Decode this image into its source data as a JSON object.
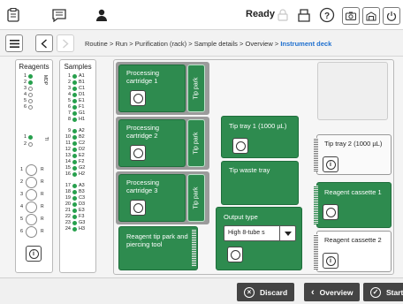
{
  "topbar": {
    "status": "Ready"
  },
  "nav": {
    "crumbs": [
      "Routine",
      ">",
      "Run",
      ">",
      "Purification (rack)",
      ">",
      "Sample details",
      ">",
      "Overview",
      ">"
    ],
    "current": "Instrument deck"
  },
  "reagents": {
    "title": "Reagents",
    "rows1": [
      {
        "n": "1",
        "f": true
      },
      {
        "n": "2",
        "f": true
      },
      {
        "n": "3",
        "f": false
      },
      {
        "n": "4",
        "f": false
      },
      {
        "n": "5",
        "f": false
      },
      {
        "n": "6",
        "f": false
      }
    ],
    "side1": "MDP",
    "rows2": [
      {
        "n": "1",
        "f": true
      },
      {
        "n": "2",
        "f": false
      }
    ],
    "side2": "TI",
    "big": [
      {
        "n": "1"
      },
      {
        "n": "2"
      },
      {
        "n": "3"
      },
      {
        "n": "4"
      },
      {
        "n": "5"
      },
      {
        "n": "6"
      }
    ],
    "bigside": [
      "R",
      "R",
      "R",
      "R",
      "R",
      "R"
    ]
  },
  "samples": {
    "title": "Samples",
    "groups": [
      [
        {
          "n": "1",
          "l": "A1"
        },
        {
          "n": "2",
          "l": "B1"
        },
        {
          "n": "3",
          "l": "C1"
        },
        {
          "n": "4",
          "l": "D1"
        },
        {
          "n": "5",
          "l": "E1"
        },
        {
          "n": "6",
          "l": "F1"
        },
        {
          "n": "7",
          "l": "G1"
        },
        {
          "n": "8",
          "l": "H1"
        }
      ],
      [
        {
          "n": "9",
          "l": "A2"
        },
        {
          "n": "10",
          "l": "B2"
        },
        {
          "n": "11",
          "l": "C2"
        },
        {
          "n": "12",
          "l": "D2"
        },
        {
          "n": "13",
          "l": "E2"
        },
        {
          "n": "14",
          "l": "F2"
        },
        {
          "n": "15",
          "l": "G2"
        },
        {
          "n": "16",
          "l": "H2"
        }
      ],
      [
        {
          "n": "17",
          "l": "A3"
        },
        {
          "n": "18",
          "l": "B3"
        },
        {
          "n": "19",
          "l": "C3"
        },
        {
          "n": "20",
          "l": "D3"
        },
        {
          "n": "21",
          "l": "E3"
        },
        {
          "n": "22",
          "l": "F3"
        },
        {
          "n": "23",
          "l": "G3"
        },
        {
          "n": "24",
          "l": "H3"
        }
      ]
    ]
  },
  "deck": {
    "cart1": "Processing cartridge 1",
    "cart2": "Processing cartridge 2",
    "cart3": "Processing cartridge 3",
    "tip_park": "Tip park",
    "tiptray1": "Tip tray 1 (1000 µL)",
    "tipwaste": "Tip waste tray",
    "output_label": "Output type",
    "output_value": "High 8-tube s",
    "reagent_tip": "Reagent tip park and piercing tool",
    "tiptray2": "Tip tray 2 (1000 µL)",
    "cassette1": "Reagent cassette 1",
    "cassette2": "Reagent cassette 2"
  },
  "bottom": {
    "discard": "Discard",
    "overview": "Overview",
    "start": "Start"
  }
}
